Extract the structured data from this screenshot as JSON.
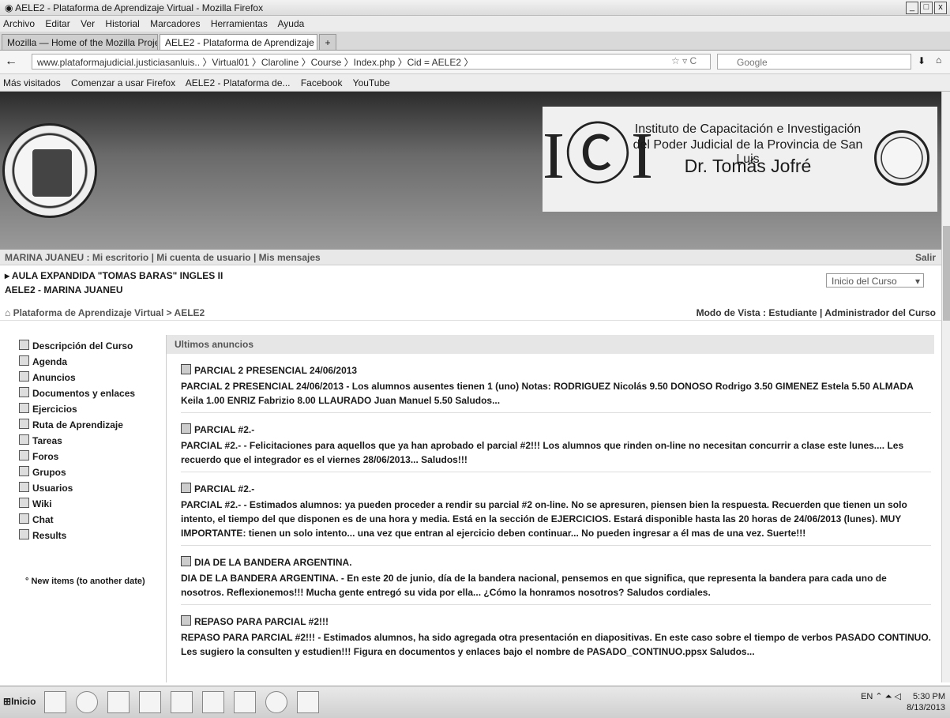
{
  "window": {
    "title": "AELE2 - Plataforma de Aprendizaje Virtual - Mozilla Firefox"
  },
  "menu": [
    "Archivo",
    "Editar",
    "Ver",
    "Historial",
    "Marcadores",
    "Herramientas",
    "Ayuda"
  ],
  "tabs": [
    {
      "label": "Mozilla — Home of the Mozilla Proje..."
    },
    {
      "label": "AELE2 - Plataforma de Aprendizaje Vi..."
    }
  ],
  "nav": {
    "url": "www.plataformajudicial.justiciasanluis.. 〉Virtual01 〉Claroline 〉Course 〉Index.php 〉Cid = AELE2 〉",
    "search_placeholder": "Google"
  },
  "bookmarks": [
    "Más visitados",
    "Comenzar a usar Firefox",
    "AELE2 - Plataforma de...",
    "Facebook",
    "YouTube"
  ],
  "banner": {
    "inst_line1": "Instituto de Capacitación e Investigación",
    "inst_line2": "del Poder Judicial de la Provincia de San Luis",
    "inst_line3": "Dr. Tomás Jofré"
  },
  "userbar": {
    "text": "MARINA JUANEU : Mi escritorio | Mi cuenta de usuario | Mis mensajes",
    "salir": "Salir"
  },
  "course": {
    "title": "▸ AULA EXPANDIDA \"TOMAS BARAS\" INGLES II",
    "subtitle": "AELE2 - MARINA JUANEU",
    "select_value": "Inicio del Curso"
  },
  "breadcrumb": {
    "path": "⌂ Plataforma de Aprendizaje Virtual > AELE2",
    "mode": "Modo de Vista : Estudiante | Administrador del Curso"
  },
  "sidebar": {
    "items": [
      "Descripción del Curso",
      "Agenda",
      "Anuncios",
      "Documentos y enlaces",
      "Ejercicios",
      "Ruta de Aprendizaje",
      "Tareas",
      "Foros",
      "Grupos",
      "Usuarios",
      "Wiki",
      "Chat",
      "Results"
    ],
    "new_items": "New items (to another date)"
  },
  "announcements": {
    "header": "Ultimos anuncios",
    "items": [
      {
        "title": "PARCIAL 2 PRESENCIAL 24/06/2013",
        "body": "PARCIAL 2 PRESENCIAL 24/06/2013 - Los alumnos ausentes tienen 1 (uno) Notas:   RODRIGUEZ Nicolás 9.50 DONOSO Rodrigo 3.50 GIMENEZ Estela 5.50 ALMADA Keila 1.00 ENRIZ Fabrizio 8.00 LLAURADO Juan Manuel 5.50 Saludos..."
      },
      {
        "title": "PARCIAL #2.-",
        "body": "PARCIAL #2.- - Felicitaciones para aquellos que ya han aprobado el parcial #2!!! Los alumnos que rinden on-line no necesitan concurrir a clase este lunes.... Les recuerdo que el integrador es el viernes 28/06/2013... Saludos!!!"
      },
      {
        "title": "PARCIAL #2.-",
        "body": "PARCIAL #2.- - Estimados alumnos:  ya pueden proceder a rendir su parcial #2 on-line.  No se apresuren, piensen bien la respuesta.  Recuerden que tienen un solo intento, el tiempo del que disponen es de una hora y media.  Está en la sección de EJERCICIOS.  Estará disponible hasta las 20 horas de 24/06/2013 (lunes). MUY IMPORTANTE:  tienen un solo intento... una vez que entran al ejercicio deben continuar... No pueden ingresar a él mas de una vez. Suerte!!!"
      },
      {
        "title": "DIA DE LA BANDERA ARGENTINA.",
        "body": "DIA DE LA BANDERA ARGENTINA. - En este 20 de junio, día de la bandera nacional, pensemos en que significa, que representa la bandera para cada uno de nosotros. Reflexionemos!!!  Mucha gente entregó su vida por ella... ¿Cómo la honramos nosotros?  Saludos cordiales."
      },
      {
        "title": "REPASO PARA PARCIAL #2!!!",
        "body": "REPASO PARA PARCIAL #2!!! - Estimados alumnos, ha sido agregada otra presentación en diapositivas.  En este caso sobre el tiempo de verbos PASADO CONTINUO. Les sugiero la consulten y estudien!!! Figura en documentos y enlaces bajo el nombre de PASADO_CONTINUO.ppsx Saludos..."
      }
    ]
  },
  "taskbar": {
    "start": "Inicio",
    "lang": "EN",
    "time": "5:30 PM",
    "date": "8/13/2013"
  }
}
